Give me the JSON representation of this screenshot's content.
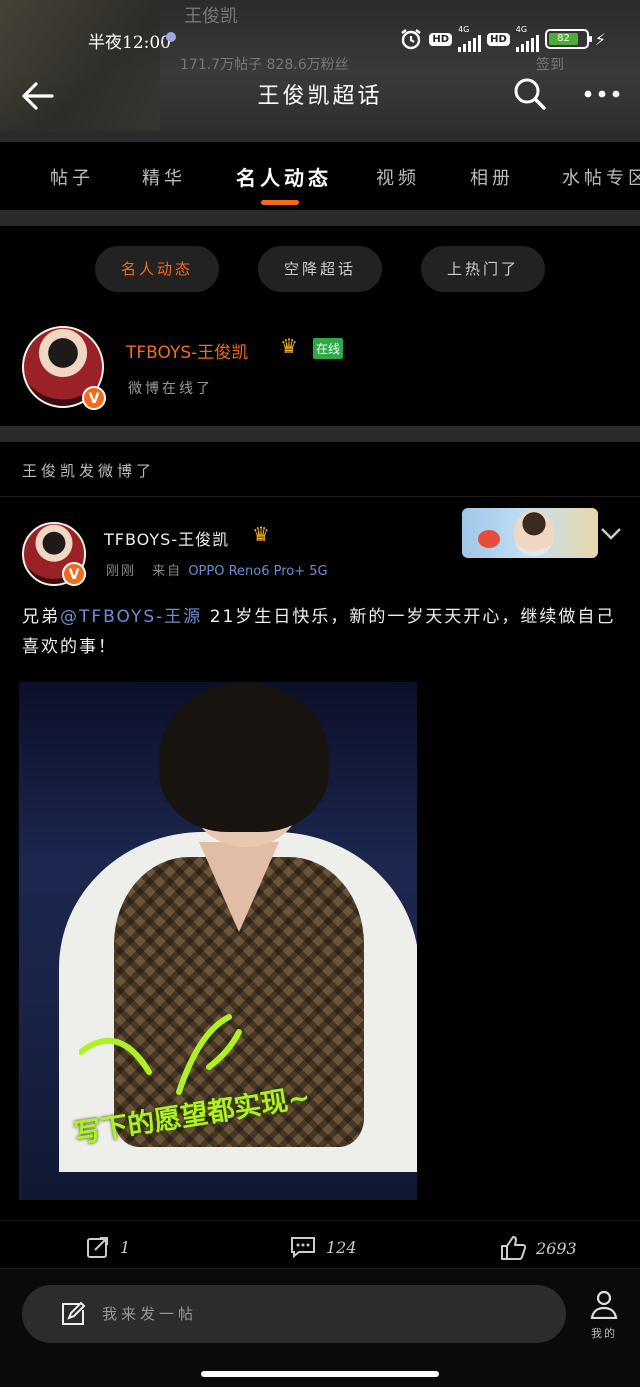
{
  "status_bar": {
    "time": "半夜12:00",
    "hd1": "HD",
    "hd2": "HD",
    "net1": "4G",
    "net2": "4G",
    "battery": "82"
  },
  "header": {
    "title": "王俊凯超话",
    "bg_text_1": "王俊凯",
    "bg_text_2": "171.7万帖子   828.6万粉丝",
    "bg_text_3": "签到"
  },
  "tabs": [
    {
      "label": "帖子",
      "active": false
    },
    {
      "label": "精华",
      "active": false
    },
    {
      "label": "名人动态",
      "active": true
    },
    {
      "label": "视频",
      "active": false
    },
    {
      "label": "相册",
      "active": false
    },
    {
      "label": "水帖专区",
      "active": false
    }
  ],
  "chips": [
    {
      "label": "名人动态",
      "active": true
    },
    {
      "label": "空降超话",
      "active": false
    },
    {
      "label": "上热门了",
      "active": false
    }
  ],
  "online_user": {
    "name": "TFBOYS-王俊凯",
    "badge": "在线",
    "subtitle": "微博在线了"
  },
  "section_label": "王俊凯发微博了",
  "post": {
    "user": "TFBOYS-王俊凯",
    "time": "刚刚",
    "source_prefix": "来自",
    "device": "OPPO Reno6 Pro+ 5G",
    "text_before": "兄弟",
    "mention": "@TFBOYS-王源",
    "text_after": " 21岁生日快乐，新的一岁天天开心，继续做自己喜欢的事！",
    "image_caption": "写下的愿望都实现~",
    "actions": {
      "repost": "1",
      "comments": "124",
      "likes": "2693"
    }
  },
  "composer": {
    "placeholder": "我来发一帖",
    "me_label": "我的"
  },
  "colors": {
    "accent": "#f26b1d",
    "mention": "#6b8fd6",
    "online_green": "#2fa84a",
    "caption_green": "#aef226"
  }
}
